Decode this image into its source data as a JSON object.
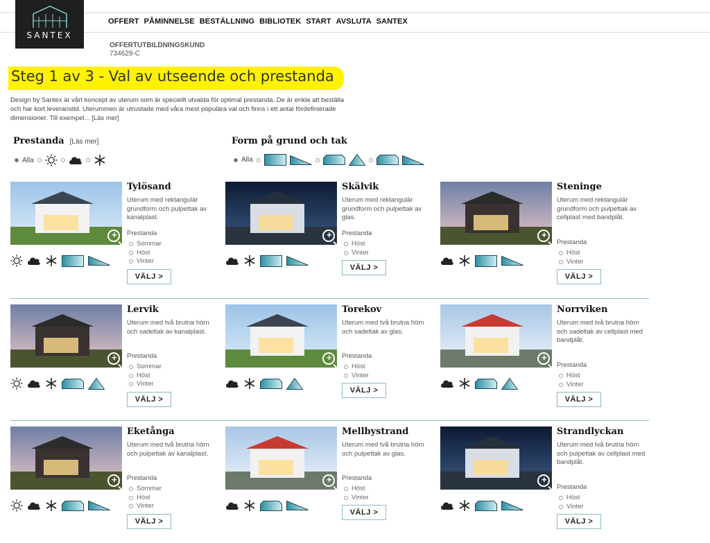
{
  "header": {
    "logo": "SANTEX",
    "nav": [
      "OFFERT",
      "PÅMINNELSE",
      "BESTÄLLNING",
      "BIBLIOTEK",
      "START",
      "AVSLUTA",
      "SANTEX"
    ],
    "customer_label": "OFFERTUTBILDNINGSKUND",
    "customer_id": "734629-C"
  },
  "page": {
    "title": "Steg 1 av 3 - Val av utseende och prestanda",
    "intro": "Design by Santex är vårt koncept av uterum som är speciellt utvalda för optimal prestanda. De är enkla att beställa och har kort leveranstid. Uterummen är utrustade med våra mest populära val och finns i ett antal fördefinierade dimensioner. Till exempel... [Läs mer]"
  },
  "filters": {
    "performance_title": "Prestanda",
    "performance_more": "[Läs mer]",
    "all_label": "Alla",
    "form_title": "Form på grund och tak"
  },
  "cards": [
    {
      "name": "Tylösand",
      "desc": "Uterum med rektangulär grundform och pulpettak av kanalplast.",
      "perf_label": "Prestanda",
      "options": [
        "Sommar",
        "Höst",
        "Vinter"
      ],
      "button": "VÄLJ >",
      "icons": [
        "sun",
        "cloud",
        "snow",
        "rect",
        "slope"
      ],
      "scene": "day"
    },
    {
      "name": "Skälvik",
      "desc": "Uterum med rektangulär grundform och pulpettak av glas.",
      "perf_label": "Prestanda",
      "options": [
        "Höst",
        "Vinter"
      ],
      "button": "VÄLJ >",
      "icons": [
        "cloud",
        "snow",
        "rect",
        "slope"
      ],
      "scene": "night"
    },
    {
      "name": "Steninge",
      "desc": "Uterum med rektangulär grundform och pulpettak av cellplast med bandplåt.",
      "perf_label": "Prestanda",
      "options": [
        "Höst",
        "Vinter"
      ],
      "button": "VÄLJ >",
      "icons": [
        "cloud",
        "snow",
        "rect",
        "slope"
      ],
      "scene": "dusk"
    },
    {
      "name": "Lervik",
      "desc": "Uterum med två brutna hörn och sadeltak av kanalplast.",
      "perf_label": "Prestanda",
      "options": [
        "Sommar",
        "Höst",
        "Vinter"
      ],
      "button": "VÄLJ >",
      "icons": [
        "sun",
        "cloud",
        "snow",
        "cut",
        "triangle"
      ],
      "scene": "dusk"
    },
    {
      "name": "Torekov",
      "desc": "Uterum med två brutna hörn och sadeltak av glas.",
      "perf_label": "Prestanda",
      "options": [
        "Höst",
        "Vinter"
      ],
      "button": "VÄLJ >",
      "icons": [
        "cloud",
        "snow",
        "cut",
        "triangle"
      ],
      "scene": "day"
    },
    {
      "name": "Norrviken",
      "desc": "Uterum med två brutna hörn och sadeltak av cellplast med bandplåt.",
      "perf_label": "Prestanda",
      "options": [
        "Höst",
        "Vinter"
      ],
      "button": "VÄLJ >",
      "icons": [
        "cloud",
        "snow",
        "cut",
        "triangle"
      ],
      "scene": "red"
    },
    {
      "name": "Eketånga",
      "desc": "Uterum med två brutna hörn och pulpettak av kanalplast.",
      "perf_label": "Prestanda",
      "options": [
        "Sommar",
        "Höst",
        "Vinter"
      ],
      "button": "VÄLJ >",
      "icons": [
        "sun",
        "cloud",
        "snow",
        "cut",
        "slope"
      ],
      "scene": "dusk"
    },
    {
      "name": "Mellbystrand",
      "desc": "Uterum med två brutna hörn och pulpettak av glas.",
      "perf_label": "Prestanda",
      "options": [
        "Höst",
        "Vinter"
      ],
      "button": "VÄLJ >",
      "icons": [
        "cloud",
        "snow",
        "cut",
        "slope"
      ],
      "scene": "red"
    },
    {
      "name": "Strandlyckan",
      "desc": "Uterum med två brutna hörn och pulpettak av cellplast med bandplåt.",
      "perf_label": "Prestanda",
      "options": [
        "Höst",
        "Vinter"
      ],
      "button": "VÄLJ >",
      "icons": [
        "cloud",
        "snow",
        "cut",
        "slope"
      ],
      "scene": "night"
    }
  ]
}
